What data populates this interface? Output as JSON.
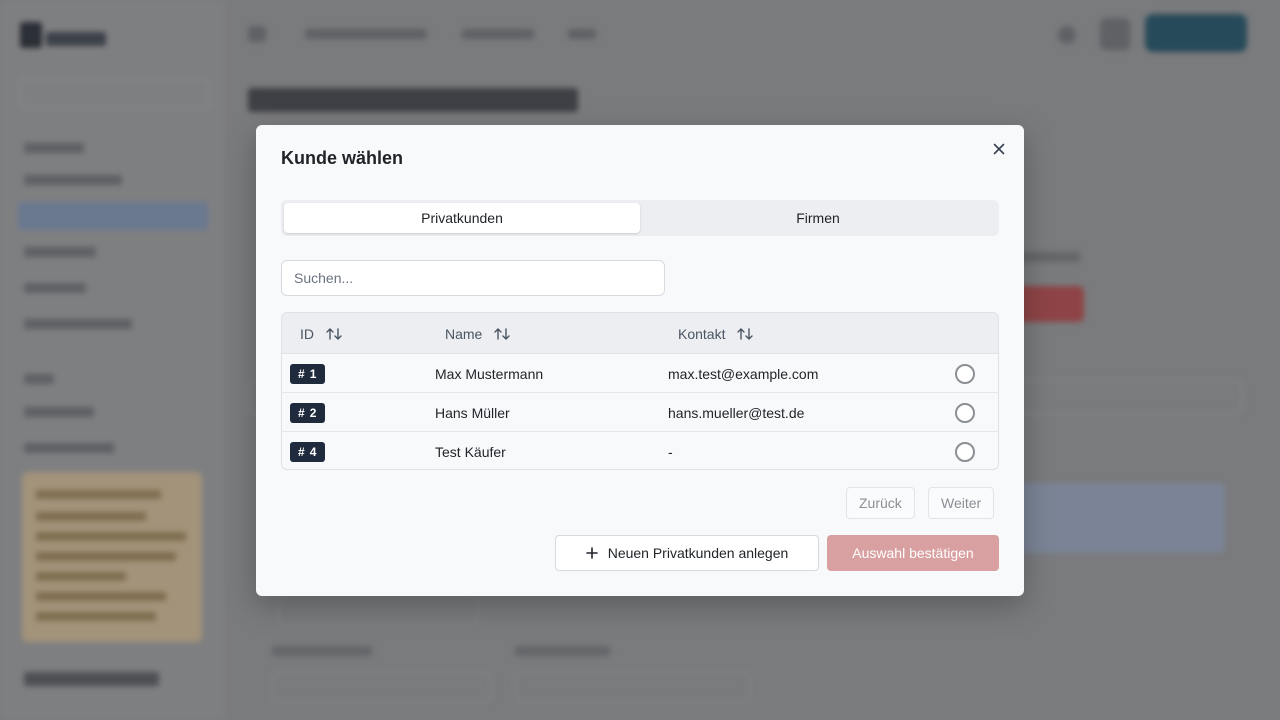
{
  "modal": {
    "title": "Kunde wählen",
    "close_icon": "close-icon",
    "tabs": [
      {
        "label": "Privatkunden",
        "active": true
      },
      {
        "label": "Firmen",
        "active": false
      }
    ],
    "search": {
      "placeholder": "Suchen...",
      "value": ""
    },
    "table": {
      "columns": [
        "ID",
        "Name",
        "Kontakt"
      ],
      "rows": [
        {
          "id": "1",
          "name": "Max Mustermann",
          "contact": "max.test@example.com",
          "selected": false
        },
        {
          "id": "2",
          "name": "Hans Müller",
          "contact": "hans.mueller@test.de",
          "selected": false
        },
        {
          "id": "4",
          "name": "Test Käufer",
          "contact": "-",
          "selected": false
        }
      ]
    },
    "pagination": {
      "prev_label": "Zurück",
      "next_label": "Weiter"
    },
    "actions": {
      "new_label": "Neuen Privatkunden anlegen",
      "confirm_label": "Auswahl bestätigen"
    }
  },
  "colors": {
    "badge_bg": "#1f2a3d",
    "confirm_disabled": "#d9a0a1",
    "overlay": "#7a7b7d"
  }
}
